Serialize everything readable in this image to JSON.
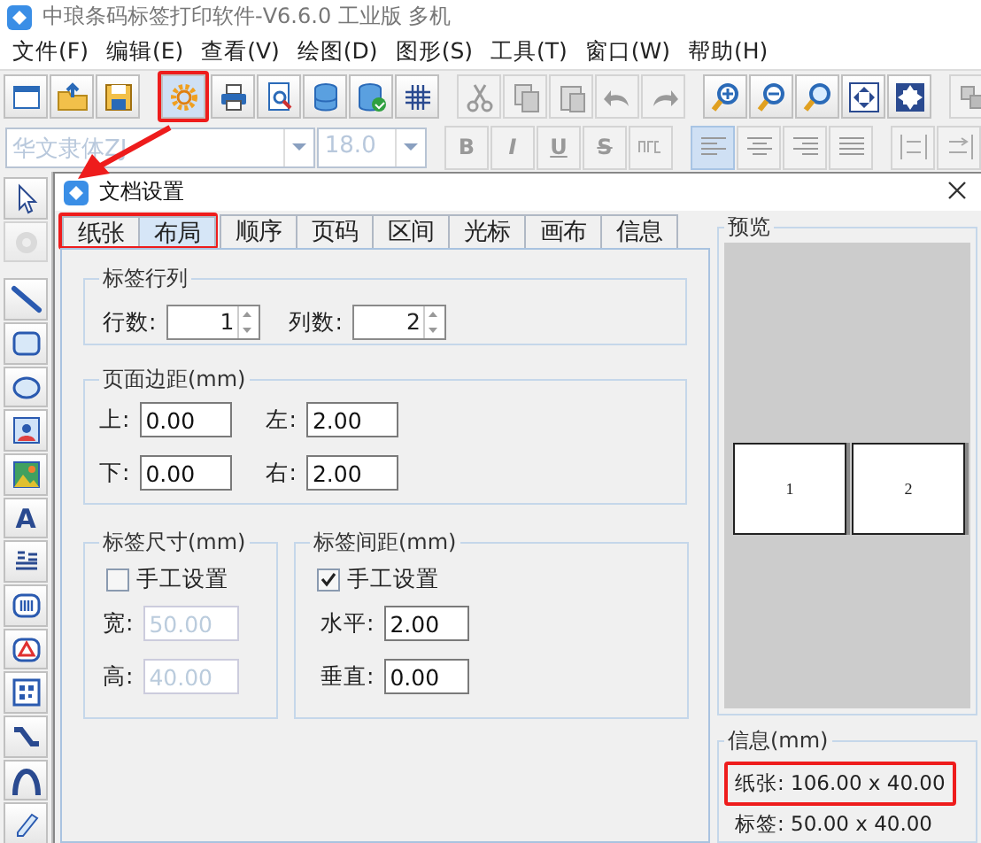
{
  "app": {
    "title": "中琅条码标签打印软件-V6.6.0 工业版 多机"
  },
  "menu": [
    {
      "label": "文件(F)"
    },
    {
      "label": "编辑(E)"
    },
    {
      "label": "查看(V)"
    },
    {
      "label": "绘图(D)"
    },
    {
      "label": "图形(S)"
    },
    {
      "label": "工具(T)"
    },
    {
      "label": "窗口(W)"
    },
    {
      "label": "帮助(H)"
    }
  ],
  "toolbar": [
    [
      {
        "kind": "window",
        "disabled": false
      },
      {
        "kind": "open",
        "disabled": false
      },
      {
        "kind": "save",
        "disabled": false
      }
    ],
    [
      {
        "kind": "gear",
        "disabled": false
      },
      {
        "kind": "print",
        "disabled": false
      },
      {
        "kind": "preview",
        "disabled": false
      },
      {
        "kind": "database",
        "disabled": false
      },
      {
        "kind": "database-check",
        "disabled": false
      },
      {
        "kind": "grid",
        "disabled": false
      }
    ],
    [
      {
        "kind": "cut",
        "disabled": true
      },
      {
        "kind": "copy",
        "disabled": true
      },
      {
        "kind": "paste",
        "disabled": true
      },
      {
        "kind": "undo",
        "disabled": true
      },
      {
        "kind": "redo",
        "disabled": true
      }
    ],
    [
      {
        "kind": "zoom-in",
        "disabled": false
      },
      {
        "kind": "zoom-out",
        "disabled": false
      },
      {
        "kind": "zoom",
        "disabled": false
      },
      {
        "kind": "fit",
        "disabled": false
      },
      {
        "kind": "fit-page",
        "disabled": false
      }
    ],
    [
      {
        "kind": "layers",
        "disabled": true
      }
    ]
  ],
  "format_bar": {
    "font": "华文隶体ZJ",
    "size": "18.0",
    "styles": [
      "B",
      "I",
      "U",
      "S"
    ],
    "align": [
      {
        "kind": "left",
        "selected": true
      },
      {
        "kind": "center",
        "selected": false
      },
      {
        "kind": "right",
        "selected": false
      },
      {
        "kind": "justify",
        "selected": false
      }
    ]
  },
  "tools": [
    {
      "kind": "pointer",
      "disabled": false
    },
    {
      "kind": "rotate",
      "disabled": true
    },
    {
      "kind": "line",
      "disabled": false
    },
    {
      "kind": "rect",
      "disabled": false
    },
    {
      "kind": "ellipse",
      "disabled": false
    },
    {
      "kind": "portrait",
      "disabled": false
    },
    {
      "kind": "image",
      "disabled": false
    },
    {
      "kind": "text",
      "glyph": "A",
      "disabled": false
    },
    {
      "kind": "paragraph",
      "disabled": false
    },
    {
      "kind": "barcode",
      "disabled": false
    },
    {
      "kind": "warning",
      "disabled": false
    },
    {
      "kind": "qrcode",
      "disabled": false
    },
    {
      "kind": "curve",
      "disabled": false
    },
    {
      "kind": "arc",
      "disabled": false
    },
    {
      "kind": "edit",
      "disabled": false
    }
  ],
  "dialog": {
    "title": "文档设置",
    "tabs": [
      {
        "label": "纸张",
        "selected": false
      },
      {
        "label": "布局",
        "selected": true
      },
      {
        "label": "顺序",
        "selected": false
      },
      {
        "label": "页码",
        "selected": false
      },
      {
        "label": "区间",
        "selected": false
      },
      {
        "label": "光标",
        "selected": false
      },
      {
        "label": "画布",
        "selected": false
      },
      {
        "label": "信息",
        "selected": false
      }
    ],
    "rows_cols": {
      "title": "标签行列",
      "fields": [
        {
          "label": "行数:",
          "value": "1"
        },
        {
          "label": "列数:",
          "value": "2"
        }
      ]
    },
    "margins": {
      "title": "页面边距(mm)",
      "fields": [
        {
          "label": "上:",
          "value": "0.00"
        },
        {
          "label": "左:",
          "value": "2.00"
        },
        {
          "label": "下:",
          "value": "0.00"
        },
        {
          "label": "右:",
          "value": "2.00"
        }
      ]
    },
    "label_size": {
      "title": "标签尺寸(mm)",
      "manual": {
        "label": "手工设置",
        "checked": false
      },
      "fields": [
        {
          "label": "宽:",
          "value": "50.00",
          "disabled": true
        },
        {
          "label": "高:",
          "value": "40.00",
          "disabled": true
        }
      ]
    },
    "label_gap": {
      "title": "标签间距(mm)",
      "manual": {
        "label": "手工设置",
        "checked": true
      },
      "fields": [
        {
          "label": "水平:",
          "value": "2.00",
          "disabled": false
        },
        {
          "label": "垂直:",
          "value": "0.00",
          "disabled": false
        }
      ]
    },
    "preview": {
      "title": "预览",
      "labels": [
        "1",
        "2"
      ]
    },
    "info": {
      "title": "信息(mm)",
      "lines": [
        "纸张: 106.00 x 40.00",
        "标签: 50.00 x 40.00"
      ]
    }
  }
}
